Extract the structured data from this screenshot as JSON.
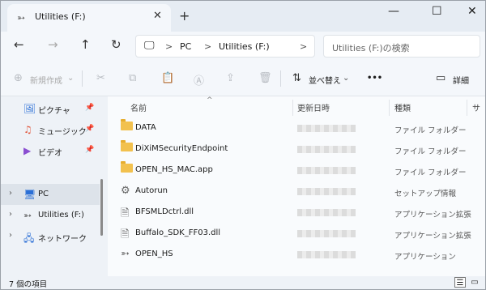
{
  "tab": {
    "title": "Utilities (F:)",
    "close": "✕",
    "new": "+"
  },
  "window_controls": {
    "minimize": "—",
    "maximize": "☐",
    "close": "✕"
  },
  "nav_buttons": {
    "back": "←",
    "forward": "→",
    "up": "↑",
    "refresh": "↻"
  },
  "address": {
    "segments": [
      "PC",
      "Utilities (F:)"
    ],
    "sep": ">"
  },
  "search": {
    "placeholder": "Utilities (F:)の検索"
  },
  "commands": {
    "new_label": "新規作成",
    "sort_label": "並べ替え",
    "more": "•••",
    "details_label": "詳細"
  },
  "sidebar": {
    "quick": [
      {
        "label": "ピクチャ"
      },
      {
        "label": "ミュージック"
      },
      {
        "label": "ビデオ"
      }
    ],
    "tree": [
      {
        "label": "PC"
      },
      {
        "label": "Utilities (F:)"
      },
      {
        "label": "ネットワーク"
      }
    ]
  },
  "columns": {
    "name": "名前",
    "date": "更新日時",
    "type": "種類",
    "size": "サ"
  },
  "files": [
    {
      "name": "DATA",
      "type": "ファイル フォルダー",
      "icon": "folder-icon"
    },
    {
      "name": "DiXiMSecurityEndpoint",
      "type": "ファイル フォルダー",
      "icon": "folder-icon"
    },
    {
      "name": "OPEN_HS_MAC.app",
      "type": "ファイル フォルダー",
      "icon": "folder-icon"
    },
    {
      "name": "Autorun",
      "type": "セットアップ情報",
      "icon": "settings-file-icon"
    },
    {
      "name": "BFSMLDctrl.dll",
      "type": "アプリケーション拡張",
      "icon": "dll-file-icon"
    },
    {
      "name": "Buffalo_SDK_FF03.dll",
      "type": "アプリケーション拡張",
      "icon": "dll-file-icon"
    },
    {
      "name": "OPEN_HS",
      "type": "アプリケーション",
      "icon": "app-icon"
    }
  ],
  "status": {
    "count": "7 個の項目"
  }
}
